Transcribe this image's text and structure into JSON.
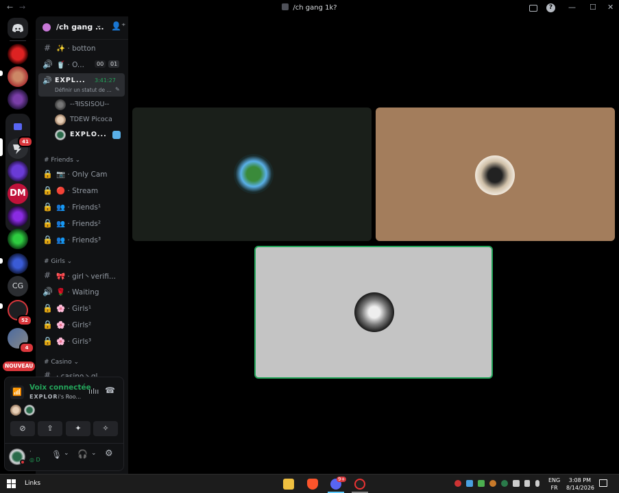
{
  "titlebar": {
    "title": "/ch gang 1k?",
    "back": "←",
    "forward": "→",
    "inbox_icon": "inbox-icon",
    "help": "?",
    "minimize": "—",
    "maximize": "☐",
    "close": "✕"
  },
  "servers": {
    "badges": [
      "41",
      "52",
      "4"
    ],
    "cg_label": "CG",
    "new_label": "NOUVEAU",
    "dm_label": "DM"
  },
  "guild": {
    "name": "/ch gang ...",
    "channels_top": [
      {
        "icon": "#",
        "emoji": "✨",
        "label": "· botton"
      },
      {
        "icon": "🔊",
        "emoji": "🥤",
        "label": "· O...",
        "counter_a": "00",
        "counter_b": "01"
      }
    ],
    "active_channel": {
      "name": "𝗘𝗫𝗣𝗟...",
      "timer": "3:41:27",
      "status": "Définir un statut de ..."
    },
    "voice_users": [
      {
        "name": "--ꟻISSISOU--"
      },
      {
        "name": "TDEW Picoca"
      },
      {
        "name": "𝗘𝗫𝗣𝗟𝗢..."
      }
    ],
    "categories": {
      "friends": "# Friends ⌄",
      "girls": "# Girls ⌄",
      "casino": "# Casino ⌄"
    },
    "friends_channels": [
      {
        "emoji": "📷",
        "label": "· Only Cam"
      },
      {
        "emoji": "🔴",
        "label": "· Stream"
      },
      {
        "emoji": "👥",
        "label": "· Friends¹"
      },
      {
        "emoji": "👥",
        "label": "· Friends²"
      },
      {
        "emoji": "👥",
        "label": "· Friends³"
      }
    ],
    "girls_channels": [
      {
        "icon": "#",
        "emoji": "🎀",
        "label": "· girl丶verifi..."
      },
      {
        "icon": "🔊",
        "emoji": "🌹",
        "label": "· Waiting"
      },
      {
        "icon": "🔒",
        "emoji": "🌸",
        "label": "· Girls¹"
      },
      {
        "icon": "🔒",
        "emoji": "🌸",
        "label": "· Girls²"
      },
      {
        "icon": "🔒",
        "emoji": "🌸",
        "label": "· Girls³"
      }
    ],
    "casino_partial": "· casino丶gl..."
  },
  "voice_panel": {
    "status": "Voix connectée",
    "channel": "𝗘𝗫𝗣𝗟𝗢𝗥",
    "channel_suffix": "i's Roo..."
  },
  "user_panel": {
    "name": "·",
    "status_short": "D"
  },
  "stage": {
    "tiles": [
      {
        "name": "tile-1",
        "bg": "#1a1f1a"
      },
      {
        "name": "tile-2",
        "bg": "#a37d5c"
      },
      {
        "name": "tile-3",
        "bg": "#c4c4c4",
        "speaking": true
      }
    ]
  },
  "taskbar": {
    "links": "Links",
    "discord_badge": "9+",
    "lang": "ENG",
    "region": "FR",
    "time": "3:08 PM",
    "date": "8/14/2026"
  }
}
